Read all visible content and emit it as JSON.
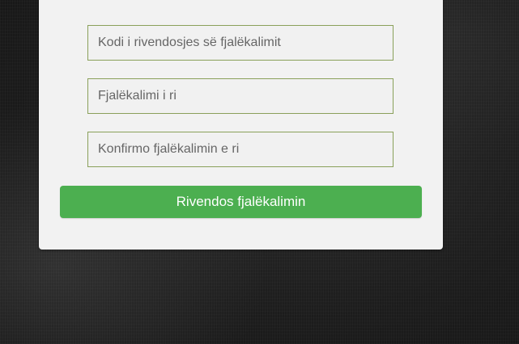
{
  "form": {
    "reset_code_placeholder": "Kodi i rivendosjes së fjalëkalimit",
    "new_password_placeholder": "Fjalëkalimi i ri",
    "confirm_password_placeholder": "Konfirmo fjalëkalimin e ri",
    "submit_label": "Rivendos fjalëkalimin"
  },
  "colors": {
    "button": "#4caf50",
    "field_border": "#8aa05a",
    "card": "#f2f2f2",
    "background": "#1e1e1e"
  }
}
